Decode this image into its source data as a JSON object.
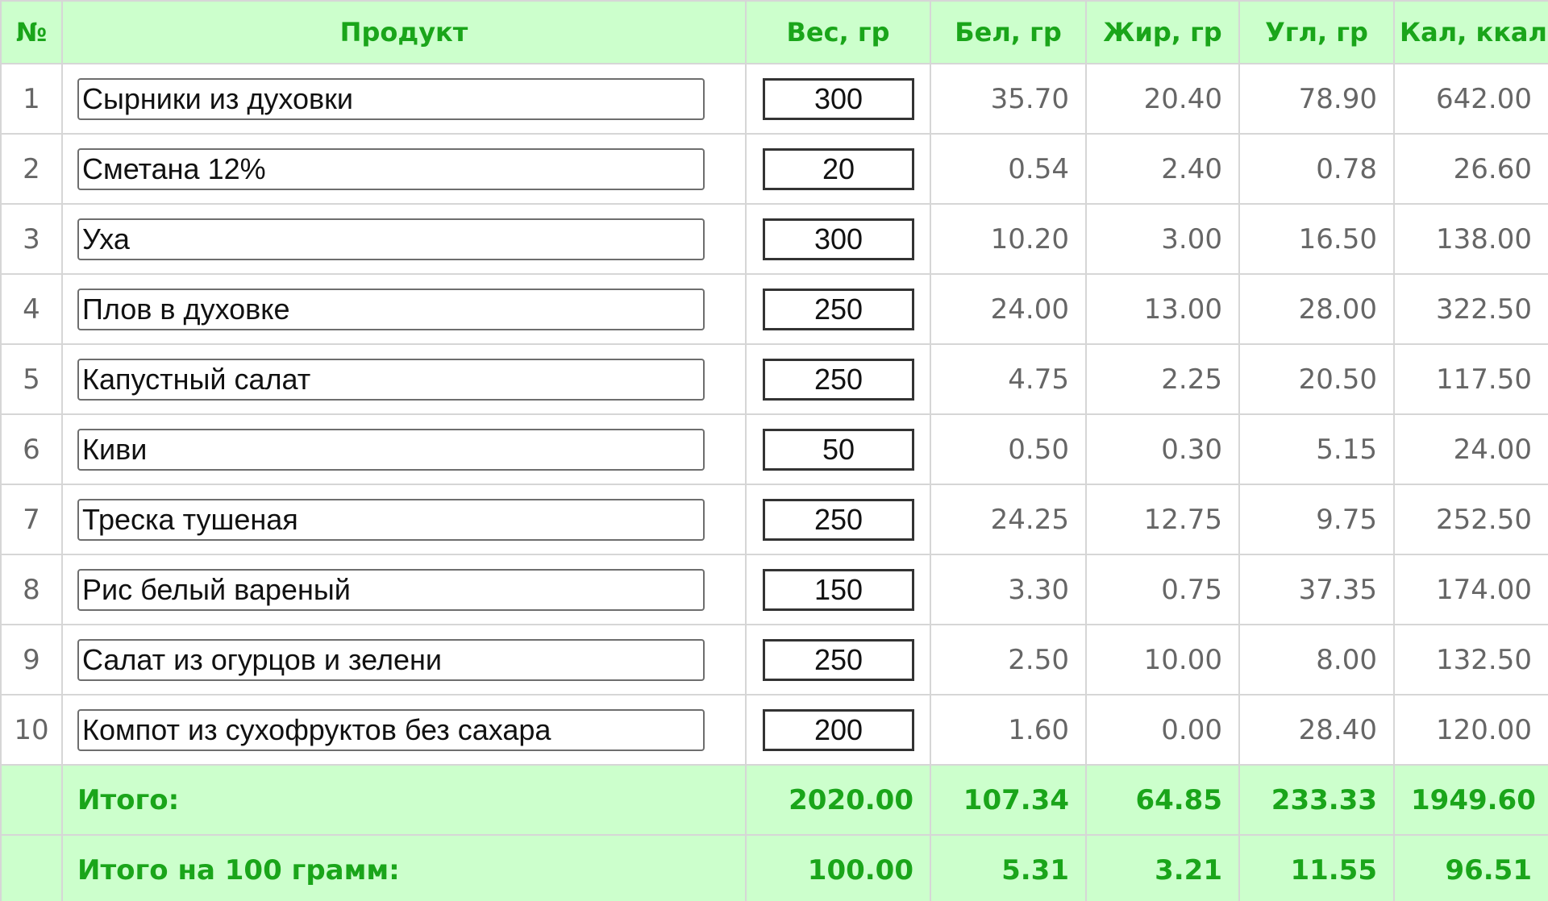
{
  "headers": {
    "num": "№",
    "product": "Продукт",
    "weight": "Вес, гр",
    "protein": "Бел, гр",
    "fat": "Жир, гр",
    "carbs": "Угл, гр",
    "kcal": "Кал, ккал"
  },
  "rows": [
    {
      "num": "1",
      "product": "Сырники из духовки",
      "weight": "300",
      "protein": "35.70",
      "fat": "20.40",
      "carbs": "78.90",
      "kcal": "642.00"
    },
    {
      "num": "2",
      "product": "Сметана 12%",
      "weight": "20",
      "protein": "0.54",
      "fat": "2.40",
      "carbs": "0.78",
      "kcal": "26.60"
    },
    {
      "num": "3",
      "product": "Уха",
      "weight": "300",
      "protein": "10.20",
      "fat": "3.00",
      "carbs": "16.50",
      "kcal": "138.00"
    },
    {
      "num": "4",
      "product": "Плов в духовке",
      "weight": "250",
      "protein": "24.00",
      "fat": "13.00",
      "carbs": "28.00",
      "kcal": "322.50"
    },
    {
      "num": "5",
      "product": "Капустный салат",
      "weight": "250",
      "protein": "4.75",
      "fat": "2.25",
      "carbs": "20.50",
      "kcal": "117.50"
    },
    {
      "num": "6",
      "product": "Киви",
      "weight": "50",
      "protein": "0.50",
      "fat": "0.30",
      "carbs": "5.15",
      "kcal": "24.00"
    },
    {
      "num": "7",
      "product": "Треска тушеная",
      "weight": "250",
      "protein": "24.25",
      "fat": "12.75",
      "carbs": "9.75",
      "kcal": "252.50"
    },
    {
      "num": "8",
      "product": "Рис белый вареный",
      "weight": "150",
      "protein": "3.30",
      "fat": "0.75",
      "carbs": "37.35",
      "kcal": "174.00"
    },
    {
      "num": "9",
      "product": "Салат из огурцов и зелени",
      "weight": "250",
      "protein": "2.50",
      "fat": "10.00",
      "carbs": "8.00",
      "kcal": "132.50"
    },
    {
      "num": "10",
      "product": "Компот из сухофруктов без сахара",
      "weight": "200",
      "protein": "1.60",
      "fat": "0.00",
      "carbs": "28.40",
      "kcal": "120.00"
    }
  ],
  "totals": {
    "label": "Итого:",
    "weight": "2020.00",
    "protein": "107.34",
    "fat": "64.85",
    "carbs": "233.33",
    "kcal": "1949.60"
  },
  "per100": {
    "label": "Итого на 100 грамм:",
    "weight": "100.00",
    "protein": "5.31",
    "fat": "3.21",
    "carbs": "11.55",
    "kcal": "96.51"
  },
  "colors": {
    "header_bg": "#ccffcc",
    "header_text": "#1aa51a",
    "cell_text": "#666666",
    "grid": "#d6d6d6"
  }
}
